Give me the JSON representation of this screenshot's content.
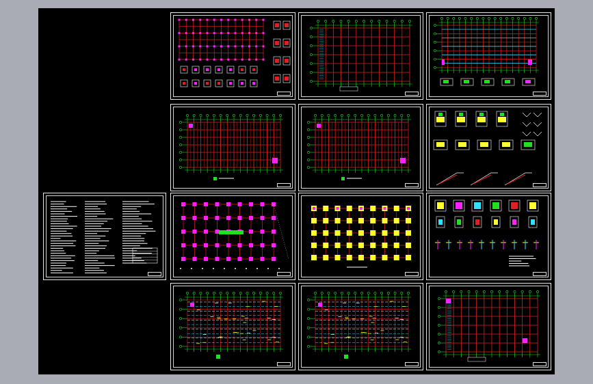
{
  "drawing_set": {
    "sheets": [
      {
        "id": "s-notes",
        "kind": "notes"
      },
      {
        "id": "s-col-1",
        "kind": "column-details"
      },
      {
        "id": "s-grid-1",
        "kind": "plan-grid"
      },
      {
        "id": "s-plan-1",
        "kind": "plan-dense"
      },
      {
        "id": "s-plan-2",
        "kind": "plan-red"
      },
      {
        "id": "s-plan-3",
        "kind": "plan-red"
      },
      {
        "id": "s-det-1",
        "kind": "details-green"
      },
      {
        "id": "s-found-1",
        "kind": "foundation-magenta"
      },
      {
        "id": "s-found-2",
        "kind": "foundation-yellow"
      },
      {
        "id": "s-det-2",
        "kind": "details-mixed"
      },
      {
        "id": "s-plan-4",
        "kind": "plan-rebar"
      },
      {
        "id": "s-plan-5",
        "kind": "plan-rebar"
      },
      {
        "id": "s-grid-2",
        "kind": "plan-grid"
      }
    ]
  },
  "colors": {
    "background": "#000000",
    "frame": "#e8e8e8",
    "grid_red": "#e02020",
    "axis_green": "#20e020",
    "magenta": "#ff20ff",
    "yellow": "#ffff30",
    "cyan": "#30e0ff",
    "white": "#ffffff"
  }
}
